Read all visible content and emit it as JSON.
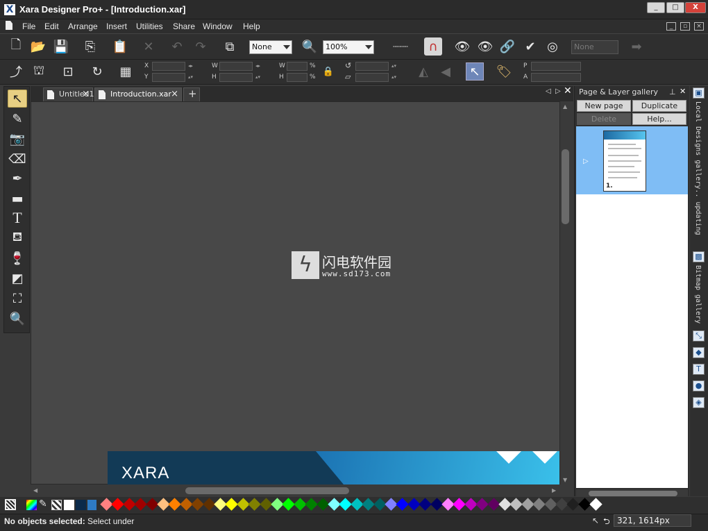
{
  "window": {
    "title": "Xara Designer Pro+ - [Introduction.xar]",
    "controls": {
      "minimize": "_",
      "maximize": "□",
      "close": "X"
    }
  },
  "menu": {
    "items": [
      {
        "label": "File"
      },
      {
        "label": "Edit"
      },
      {
        "label": "Arrange"
      },
      {
        "label": "Insert"
      },
      {
        "label": "Utilities"
      },
      {
        "label": "Share"
      },
      {
        "label": "Window"
      },
      {
        "label": "Help"
      }
    ]
  },
  "toolbar": {
    "quality_combo": "None",
    "zoom_combo": "100%",
    "disabled_combo": "None"
  },
  "infobar": {
    "x_label": "X",
    "y_label": "Y",
    "w_label": "W",
    "h_label": "H",
    "w2_label": "W",
    "h2_label": "H",
    "pct1": "%",
    "pct2": "%",
    "p_label": "P",
    "a_label": "A"
  },
  "tabs": [
    {
      "label": "Untitled1",
      "active": false
    },
    {
      "label": "Introduction.xar",
      "active": true
    }
  ],
  "canvas": {
    "banner_brand": "XARA",
    "watermark_cn": "闪电软件园",
    "watermark_url": "www.sd173.com"
  },
  "gallery": {
    "title": "Page & Layer gallery",
    "buttons": {
      "new_page": "New page",
      "duplicate": "Duplicate",
      "delete": "Delete",
      "help": "Help..."
    },
    "page_number": "1."
  },
  "right_strip": {
    "local_designs": "Local Designs gallery.. updating",
    "bitmap_gallery": "Bitmap gallery"
  },
  "palette": {
    "colors": [
      "#ff8080",
      "#ff0000",
      "#c00000",
      "#a00000",
      "#800000",
      "#ffc080",
      "#ff8000",
      "#c06000",
      "#804000",
      "#603000",
      "#ffff80",
      "#ffff00",
      "#c0c000",
      "#808000",
      "#606000",
      "#80ff80",
      "#00ff00",
      "#00c000",
      "#008000",
      "#006000",
      "#80ffff",
      "#00ffff",
      "#00c0c0",
      "#008080",
      "#006060",
      "#8080ff",
      "#0000ff",
      "#0000c0",
      "#000080",
      "#000060",
      "#ff80ff",
      "#ff00ff",
      "#c000c0",
      "#800080",
      "#600060",
      "#e0e0e0",
      "#c0c0c0",
      "#a0a0a0",
      "#808080",
      "#606060",
      "#404040",
      "#202020",
      "#000000",
      "#ffffff"
    ]
  },
  "status": {
    "bold": "No objects selected:",
    "message": "Select under",
    "coords": "321, 1614px"
  }
}
